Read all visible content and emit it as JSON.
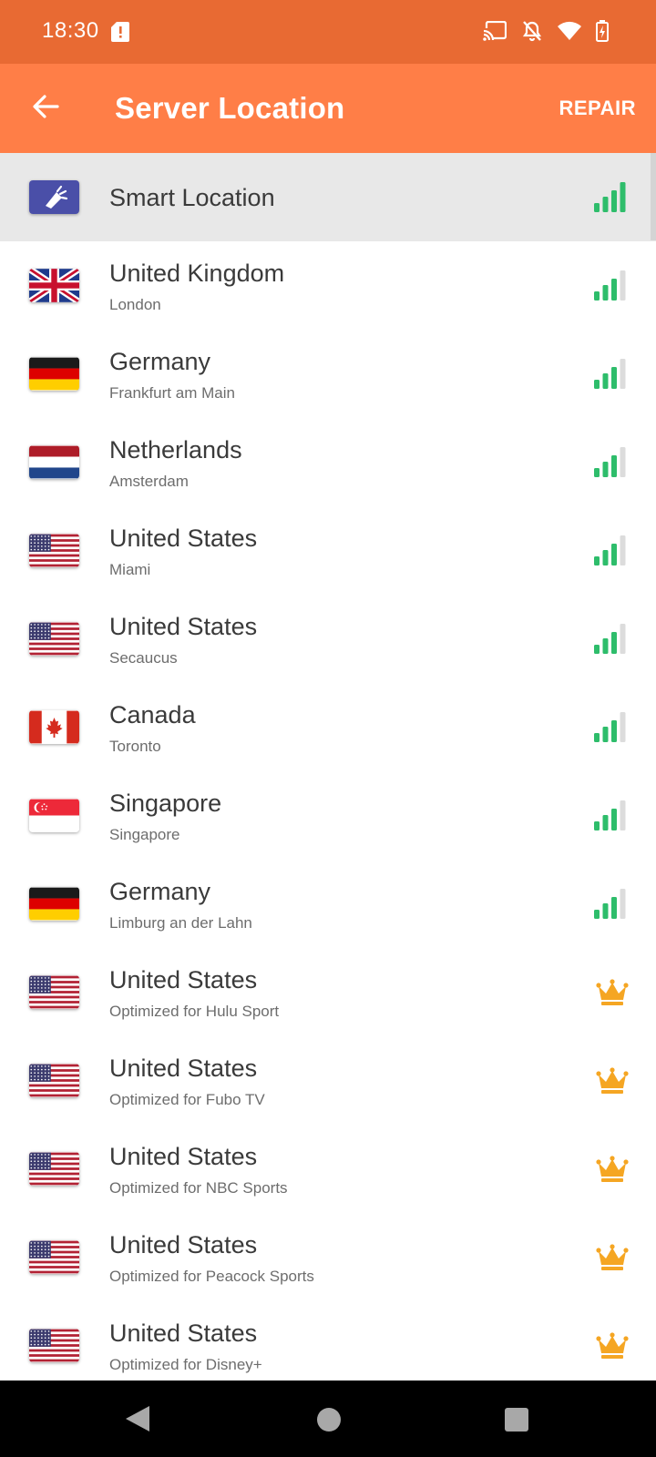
{
  "status_bar": {
    "time": "18:30",
    "icons": [
      "sd-card-alert-icon",
      "cast-icon",
      "notifications-off-icon",
      "wifi-icon",
      "battery-charging-icon"
    ]
  },
  "app_bar": {
    "title": "Server Location",
    "action_label": "REPAIR",
    "back_icon": "arrow-back-icon"
  },
  "colors": {
    "status_bar": "#e86a33",
    "app_bar": "#ff7e47",
    "signal_green": "#2ebd6b",
    "signal_gray": "#dcdcdc",
    "crown": "#f5a623",
    "selected_row": "#e8e8e8"
  },
  "locations": [
    {
      "country": "Smart Location",
      "city": "",
      "flag": "smart",
      "indicator": "signal",
      "signal_bars": 4,
      "selected": true
    },
    {
      "country": "United Kingdom",
      "city": "London",
      "flag": "uk",
      "indicator": "signal",
      "signal_bars": 3
    },
    {
      "country": "Germany",
      "city": "Frankfurt am Main",
      "flag": "de",
      "indicator": "signal",
      "signal_bars": 3
    },
    {
      "country": "Netherlands",
      "city": "Amsterdam",
      "flag": "nl",
      "indicator": "signal",
      "signal_bars": 3
    },
    {
      "country": "United States",
      "city": "Miami",
      "flag": "us",
      "indicator": "signal",
      "signal_bars": 3
    },
    {
      "country": "United States",
      "city": "Secaucus",
      "flag": "us",
      "indicator": "signal",
      "signal_bars": 3
    },
    {
      "country": "Canada",
      "city": "Toronto",
      "flag": "ca",
      "indicator": "signal",
      "signal_bars": 3
    },
    {
      "country": "Singapore",
      "city": "Singapore",
      "flag": "sg",
      "indicator": "signal",
      "signal_bars": 3
    },
    {
      "country": "Germany",
      "city": "Limburg an der Lahn",
      "flag": "de",
      "indicator": "signal",
      "signal_bars": 3
    },
    {
      "country": "United States",
      "city": "Optimized for Hulu Sport",
      "flag": "us",
      "indicator": "crown"
    },
    {
      "country": "United States",
      "city": "Optimized for Fubo TV",
      "flag": "us",
      "indicator": "crown"
    },
    {
      "country": "United States",
      "city": "Optimized for NBC Sports",
      "flag": "us",
      "indicator": "crown"
    },
    {
      "country": "United States",
      "city": "Optimized for Peacock Sports",
      "flag": "us",
      "indicator": "crown"
    },
    {
      "country": "United States",
      "city": "Optimized for Disney+",
      "flag": "us",
      "indicator": "crown"
    }
  ],
  "nav_bar": {
    "buttons": [
      "nav-back-icon",
      "nav-home-icon",
      "nav-recents-icon"
    ]
  }
}
